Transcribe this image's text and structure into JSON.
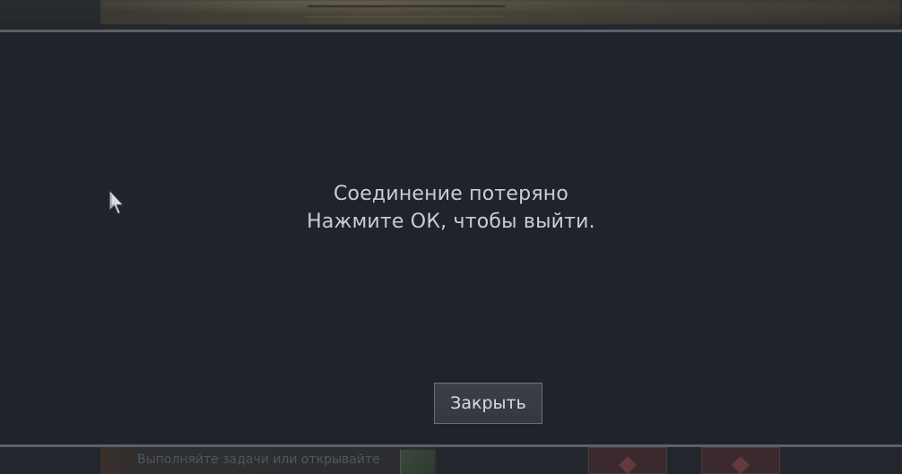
{
  "dialog": {
    "message_line1": "Соединение потеряно",
    "message_line2": "Нажмите ОК, чтобы выйти.",
    "close_label": "Закрыть"
  },
  "background": {
    "task_text": "Выполняйте задачи или открывайте"
  },
  "colors": {
    "dialog_bg": "#1f232b",
    "text": "#c9ced6",
    "button_bg": "#383d45",
    "button_border": "#6b7079",
    "divider": "#5c6067"
  },
  "icons": {
    "cursor": "mouse-pointer-icon"
  }
}
